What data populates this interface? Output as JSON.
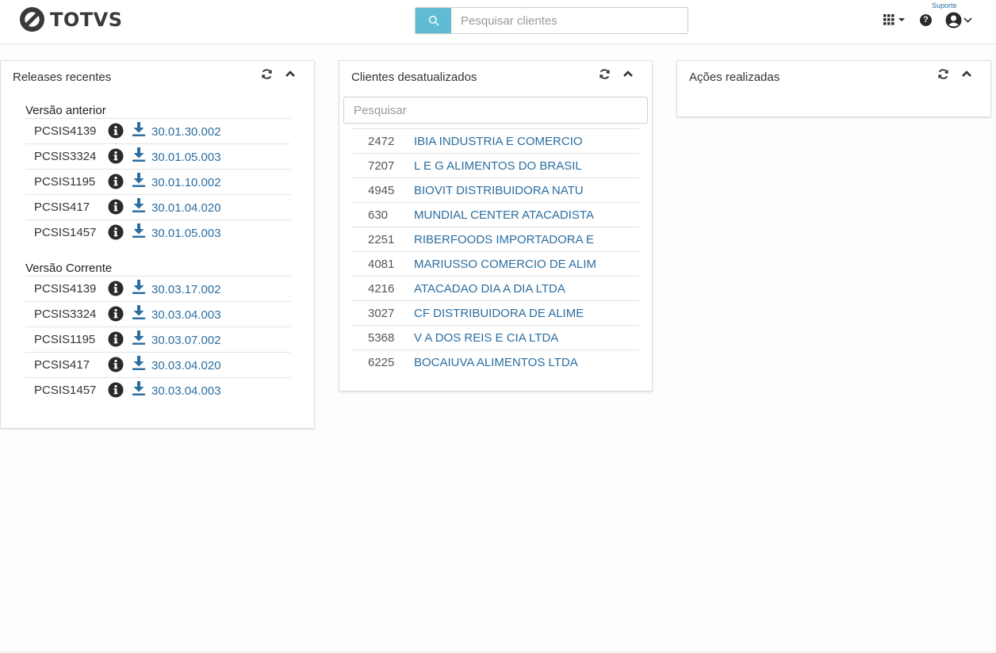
{
  "header": {
    "brand": "TOTVS",
    "search_placeholder": "Pesquisar clientes",
    "support_label": "Suporte",
    "icons": [
      "search-icon",
      "apps-grid-icon",
      "help-icon",
      "user-circle-icon"
    ]
  },
  "colors": {
    "accent": "#5fbcd3",
    "link": "#2c6ea0",
    "text": "#333333"
  },
  "releases_card": {
    "title": "Releases recentes",
    "sections": [
      {
        "title": "Versão anterior",
        "items": [
          {
            "code": "PCSIS4139",
            "version": "30.01.30.002"
          },
          {
            "code": "PCSIS3324",
            "version": "30.01.05.003"
          },
          {
            "code": "PCSIS1195",
            "version": "30.01.10.002"
          },
          {
            "code": "PCSIS417",
            "version": "30.01.04.020"
          },
          {
            "code": "PCSIS1457",
            "version": "30.01.05.003"
          }
        ]
      },
      {
        "title": "Versão Corrente",
        "items": [
          {
            "code": "PCSIS4139",
            "version": "30.03.17.002"
          },
          {
            "code": "PCSIS3324",
            "version": "30.03.04.003"
          },
          {
            "code": "PCSIS1195",
            "version": "30.03.07.002"
          },
          {
            "code": "PCSIS417",
            "version": "30.03.04.020"
          },
          {
            "code": "PCSIS1457",
            "version": "30.03.04.003"
          }
        ]
      }
    ]
  },
  "clients_card": {
    "title": "Clientes desatualizados",
    "filter_placeholder": "Pesquisar",
    "clients": [
      {
        "code": "2472",
        "name": "IBIA INDUSTRIA E COMERCIO"
      },
      {
        "code": "7207",
        "name": "L E G ALIMENTOS DO BRASIL"
      },
      {
        "code": "4945",
        "name": "BIOVIT DISTRIBUIDORA NATU"
      },
      {
        "code": "630",
        "name": "MUNDIAL CENTER ATACADISTA"
      },
      {
        "code": "2251",
        "name": "RIBERFOODS IMPORTADORA E"
      },
      {
        "code": "4081",
        "name": "MARIUSSO COMERCIO DE ALIM"
      },
      {
        "code": "4216",
        "name": "ATACADAO DIA A DIA LTDA"
      },
      {
        "code": "3027",
        "name": "CF DISTRIBUIDORA DE ALIME"
      },
      {
        "code": "5368",
        "name": "V A DOS REIS E CIA LTDA"
      },
      {
        "code": "6225",
        "name": "BOCAIUVA ALIMENTOS LTDA"
      }
    ]
  },
  "actions_card": {
    "title": "Ações realizadas"
  }
}
